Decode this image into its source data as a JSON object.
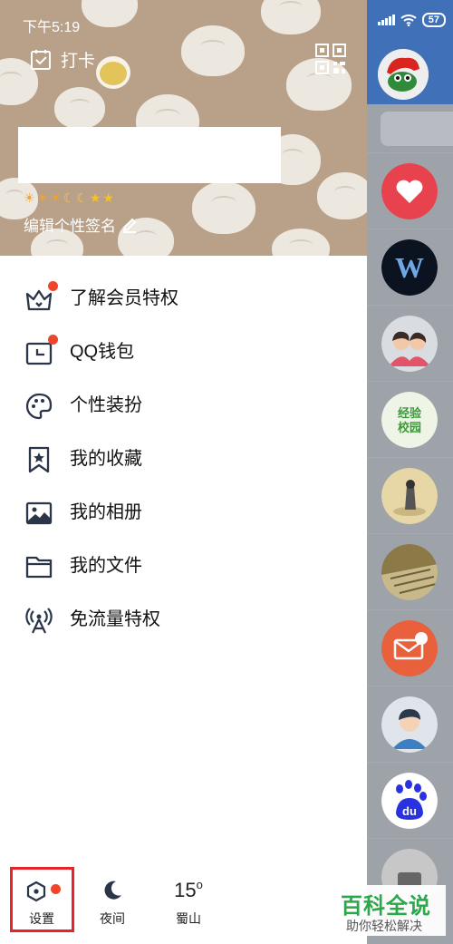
{
  "status_bar": {
    "time": "下午5:19",
    "battery": "57"
  },
  "header": {
    "checkin_label": "打卡",
    "level_icons": [
      "sun",
      "sun",
      "sun",
      "moon",
      "moon",
      "star",
      "star"
    ],
    "signature_hint": "编辑个性签名"
  },
  "menu": {
    "items": [
      {
        "label": "了解会员特权",
        "icon": "crown-icon",
        "badge": true
      },
      {
        "label": "QQ钱包",
        "icon": "wallet-icon",
        "badge": true
      },
      {
        "label": "个性装扮",
        "icon": "palette-icon",
        "badge": false
      },
      {
        "label": "我的收藏",
        "icon": "bookmark-star-icon",
        "badge": false
      },
      {
        "label": "我的相册",
        "icon": "photo-icon",
        "badge": false
      },
      {
        "label": "我的文件",
        "icon": "folder-icon",
        "badge": false
      },
      {
        "label": "免流量特权",
        "icon": "broadcast-tower-icon",
        "badge": false
      }
    ]
  },
  "bottom_bar": {
    "settings_label": "设置",
    "night_label": "夜间",
    "weather_temp": "15",
    "weather_unit": "o",
    "weather_city": "蜀山"
  },
  "watermark": {
    "title": "百科全说",
    "subtitle": "助你轻松解决"
  },
  "colors": {
    "header_bg": "#b8a188",
    "badge_red": "#f0452d",
    "highlight_red": "#e8232a",
    "strip_blue": "#3f70b8"
  }
}
